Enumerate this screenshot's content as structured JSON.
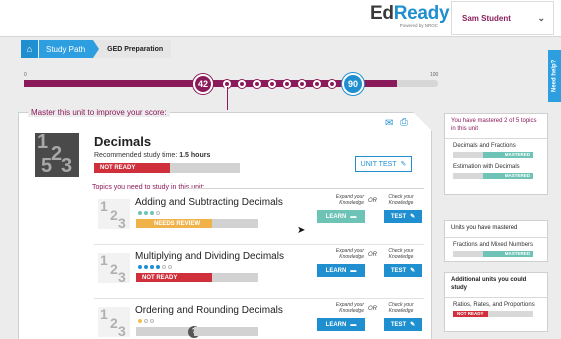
{
  "header": {
    "logo_ed": "Ed",
    "logo_ready": "Ready",
    "logo_sub": "Powered by NROC",
    "user_name": "Sam Student",
    "user_caret": "⌄"
  },
  "breadcrumb": {
    "home_icon": "⌂",
    "path_label": "Study Path",
    "current_label": "GED Preparation"
  },
  "need_help": "Need help?",
  "progress": {
    "min_label": "0",
    "max_label": "100",
    "current_score": "42",
    "target_score": "90",
    "current_value": 42,
    "target_value": 90
  },
  "unit_panel": {
    "header": "Master this unit to improve your score:",
    "email_icon": "✉",
    "print_icon": "⎙",
    "title": "Decimals",
    "time_prefix": "Recommended study time:",
    "time_value": "1.5 hours",
    "status": "NOT READY",
    "unit_test_label": "UNIT TEST",
    "topics_header": "Topics you need to study in this unit:"
  },
  "topics": [
    {
      "title": "Adding and Subtracting Decimals",
      "status": "NEEDS REVIEW",
      "status_color": "#f0b34a",
      "learn_color": "#6cc3b6",
      "dots": [
        "#6cc3b6",
        "#6cc3b6",
        "#6cc3b6",
        "#ffffff"
      ]
    },
    {
      "title": "Multiplying and Dividing Decimals",
      "status": "NOT READY",
      "status_color": "#d0303c",
      "learn_color": "#1f8fd0",
      "dots": [
        "#1f8fd0",
        "#1f8fd0",
        "#1f8fd0",
        "#1f8fd0",
        "#ffffff",
        "#ffffff"
      ]
    },
    {
      "title": "Ordering and Rounding Decimals",
      "status": "?",
      "status_color": "#888888",
      "learn_color": "#1f8fd0",
      "dots": [
        "#f0c24a",
        "#ffffff",
        "#ffffff"
      ]
    }
  ],
  "topic_actions": {
    "expand_label": "Expand your Knowledge",
    "or_label": "OR",
    "check_label": "Check your Knowledge",
    "learn_label": "LEARN",
    "test_label": "TEST"
  },
  "sidebar": {
    "mastered_topics": {
      "header": "You have mastered 2 of 5 topics in this unit",
      "items": [
        {
          "label": "Decimals and Fractions",
          "status": "MASTERED"
        },
        {
          "label": "Estimation with Decimals",
          "status": "MASTERED"
        }
      ]
    },
    "mastered_units": {
      "header": "Units you have mastered",
      "items": [
        {
          "label": "Fractions and Mixed Numbers",
          "status": "MASTERED"
        }
      ]
    },
    "additional_units": {
      "header": "Additional units you could study",
      "items": [
        {
          "label": "Ratios, Rates, and Proportions",
          "status": "NOT READY"
        }
      ]
    }
  },
  "colors": {
    "brand_purple": "#8b1a5a",
    "brand_blue": "#1f8fd0",
    "mastered_green": "#6cc3b6",
    "not_ready_red": "#d0303c",
    "needs_review_orange": "#f0b34a"
  }
}
